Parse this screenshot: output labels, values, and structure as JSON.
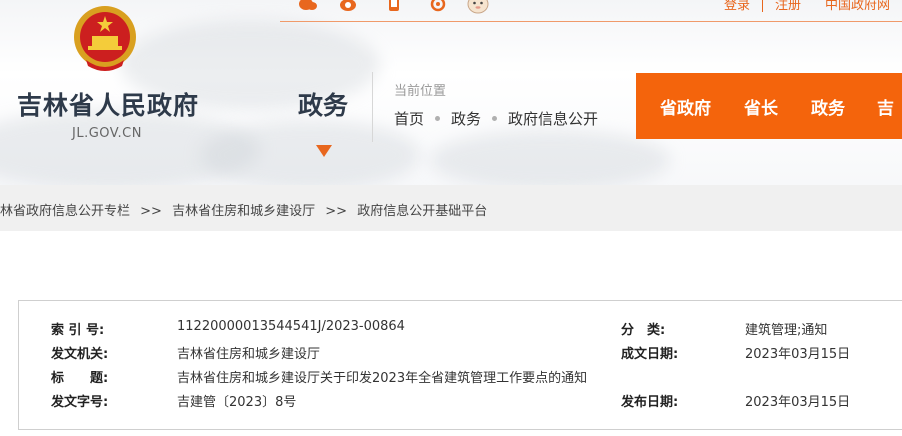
{
  "top_links": {
    "login": "登录",
    "register": "注册",
    "portal": "中国政府网"
  },
  "site": {
    "name": "吉林省人民政府",
    "domain": "JL.GOV.CN"
  },
  "section": {
    "title": "政务"
  },
  "location": {
    "label": "当前位置",
    "crumbs": [
      "首页",
      "政务",
      "政府信息公开"
    ]
  },
  "nav": {
    "items": [
      "省政府",
      "省长",
      "政务",
      "吉"
    ]
  },
  "breadcrumb": {
    "items": [
      "林省政府信息公开专栏",
      "吉林省住房和城乡建设厅",
      "政府信息公开基础平台"
    ],
    "separator": ">>"
  },
  "info": {
    "index_label": "索 引 号:",
    "index_value": "11220000013544541J/2023-00864",
    "category_label": "分　类:",
    "category_value": "建筑管理;通知",
    "issuer_label": "发文机关:",
    "issuer_value": "吉林省住房和城乡建设厅",
    "created_label": "成文日期:",
    "created_value": "2023年03月15日",
    "title_label": "标　　题:",
    "title_value": "吉林省住房和城乡建设厅关于印发2023年全省建筑管理工作要点的通知",
    "docno_label": "发文字号:",
    "docno_value": "吉建管〔2023〕8号",
    "published_label": "发布日期:",
    "published_value": "2023年03月15日"
  },
  "colors": {
    "accent": "#f4640c",
    "text_dark": "#2e3a4a",
    "band": "#f0f0f0"
  }
}
